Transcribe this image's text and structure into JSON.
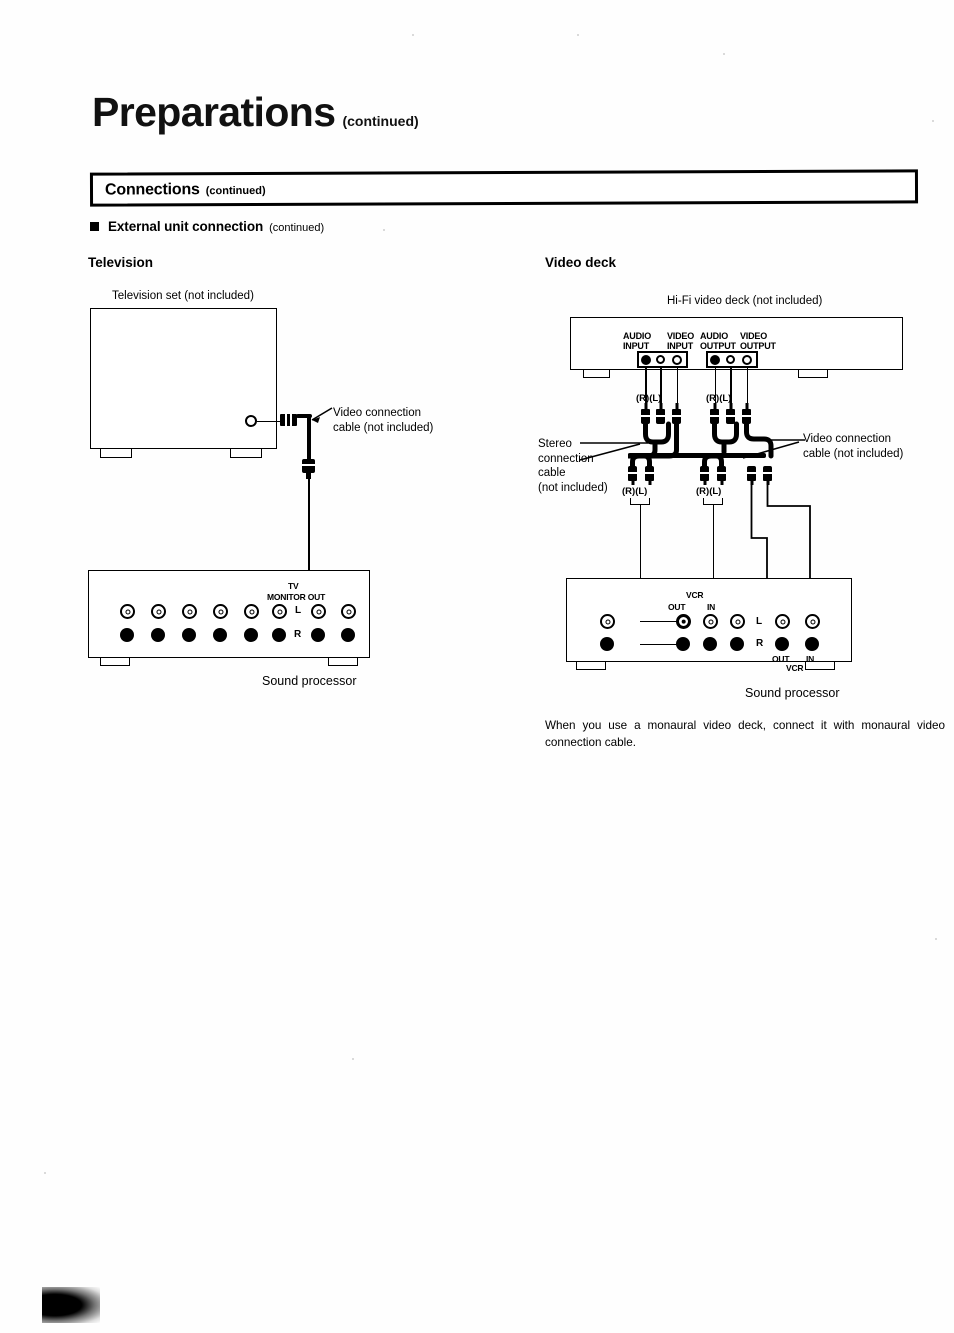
{
  "header": {
    "title": "Preparations",
    "title_suffix": "(continued)",
    "section_bar_title": "Connections",
    "section_bar_suffix": "(continued)",
    "subsection_title": "External unit connection",
    "subsection_suffix": "(continued)"
  },
  "television": {
    "heading": "Television",
    "device_caption": "Television set (not included)",
    "cable_callout_line1": "Video connection",
    "cable_callout_line2": "cable (not included)",
    "processor_name": "Sound processor",
    "jack_labels": {
      "tv": "TV",
      "monitor_out": "MONITOR OUT",
      "left": "L",
      "right": "R"
    }
  },
  "video_deck": {
    "heading": "Video deck",
    "device_caption": "Hi-Fi video deck (not included)",
    "deck_jack_labels": [
      {
        "line1": "AUDIO",
        "line2": "INPUT"
      },
      {
        "line1": "VIDEO",
        "line2": "INPUT"
      },
      {
        "line1": "AUDIO",
        "line2": "OUTPUT"
      },
      {
        "line1": "VIDEO",
        "line2": "OUTPUT"
      }
    ],
    "rl_markers": [
      "(R)(L)",
      "(R)(L)",
      "(R)(L)",
      "(R)(L)"
    ],
    "stereo_callout": [
      "Stereo",
      "connection",
      "cable",
      "(not included)"
    ],
    "video_callout_line1": "Video connection",
    "video_callout_line2": "cable (not included)",
    "processor_name": "Sound processor",
    "processor_labels": {
      "vcr_top": "VCR",
      "out_top": "OUT",
      "in_top": "IN",
      "left": "L",
      "right": "R",
      "out_bottom": "OUT",
      "in_bottom": "IN",
      "vcr_bottom": "VCR"
    },
    "note": "When you use a monaural video deck, connect it with monaural video connection cable."
  }
}
